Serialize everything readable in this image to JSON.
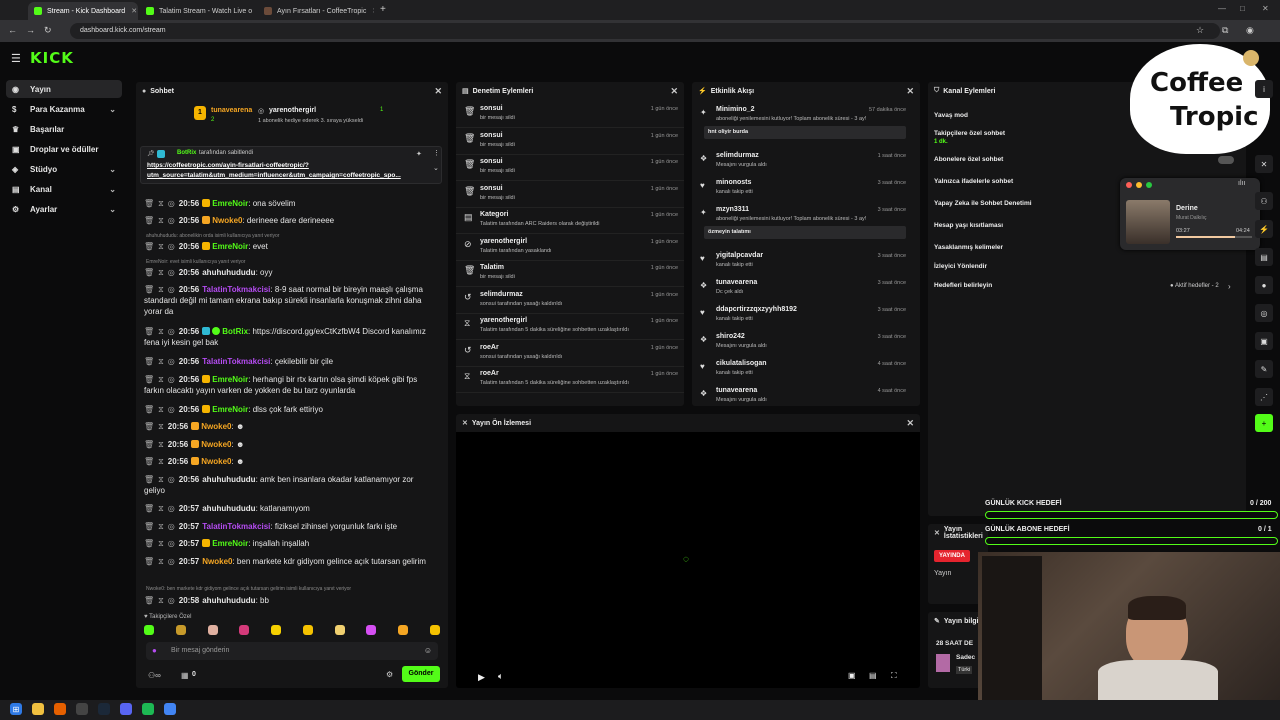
{
  "browser": {
    "tabs": [
      {
        "label": "Stream - Kick Dashboard",
        "color": "#53fc18"
      },
      {
        "label": "Talatim Stream - Watch Live o",
        "color": "#53fc18"
      },
      {
        "label": "Ayın Fırsatları - CoffeeTropic",
        "color": "#6b4b3a"
      }
    ],
    "url": "dashboard.kick.com/stream"
  },
  "brand": {
    "logo": "KICK",
    "accent": "#53fc18"
  },
  "leftnav": {
    "items": [
      {
        "label": "Yayın",
        "icon": "home-icon"
      },
      {
        "label": "Para Kazanma",
        "icon": "money-icon"
      },
      {
        "label": "Başarılar",
        "icon": "trophy-icon"
      },
      {
        "label": "Droplar ve ödüller",
        "icon": "gift-icon"
      },
      {
        "label": "Stüdyo",
        "icon": "studio-icon"
      },
      {
        "label": "Kanal",
        "icon": "channel-icon"
      },
      {
        "label": "Ayarlar",
        "icon": "gear-icon"
      }
    ]
  },
  "chat": {
    "title": "Sohbet",
    "top_user1": "tunavearena",
    "top_user1_count": "2",
    "top_user2": "yarenothergirl",
    "top_user2_count": "1",
    "top_note": "1 abonelik hediye ederek 3. sıraya yükseldi",
    "pinned_by": "BotRix",
    "pinned_label": "tarafından sabitlendi",
    "pinned_link1": "https://coffeetropic.com/ayin-firsatlari-coffeetropic/?",
    "pinned_link2": "utm_source=talatim&utm_medium=influencer&utm_campaign=coffeetropic_spo...",
    "messages": [
      {
        "time": "20:56",
        "user": "EmreNoir",
        "color": "green",
        "text": "ona sövelim"
      },
      {
        "time": "20:56",
        "user": "Nwoke0",
        "color": "orange",
        "text": "derineee dare derineeee"
      },
      {
        "reply": "ahuhuhududu: abonelikin orda isimli kullanıcıya yanıt veriyor"
      },
      {
        "time": "20:56",
        "user": "EmreNoir",
        "color": "green",
        "text": "evet"
      },
      {
        "reply": "EmreNoir: evet isimli kullanıcıya yanıt veriyor"
      },
      {
        "time": "20:56",
        "user": "ahuhuhududu",
        "color": "plain",
        "text": "oyy"
      },
      {
        "time": "20:56",
        "user": "TalatinTokmakcisi",
        "color": "purple",
        "text": "8-9 saat normal bir bireyin maaşlı çalışma standardı değil mi tamam ekrana bakıp sürekli insanlarla konuşmak zihni daha yorar da"
      },
      {
        "time": "20:56",
        "user": "BotRix",
        "color": "green",
        "text": "https://discord.gg/exCtKzfbW4 Discord kanalımız fena iyi kesin gel bak"
      },
      {
        "time": "20:56",
        "user": "TalatinTokmakcisi",
        "color": "purple",
        "text": "çekilebilir bir çile"
      },
      {
        "time": "20:56",
        "user": "EmreNoir",
        "color": "green",
        "text": "herhangi bir rtx kartın olsa şimdi köpek gibi fps farkın olacaktı yayın varken de yokken de bu tarz oyunlarda"
      },
      {
        "time": "20:56",
        "user": "EmreNoir",
        "color": "green",
        "text": "dlss çok fark ettiriyo"
      },
      {
        "time": "20:56",
        "user": "Nwoke0",
        "color": "orange",
        "text": ""
      },
      {
        "time": "20:56",
        "user": "Nwoke0",
        "color": "orange",
        "text": ""
      },
      {
        "time": "20:56",
        "user": "Nwoke0",
        "color": "orange",
        "text": ""
      },
      {
        "time": "20:56",
        "user": "ahuhuhududu",
        "color": "plain",
        "text": "amk ben insanlara okadar katlanamıyor zor geliyo"
      },
      {
        "time": "20:57",
        "user": "ahuhuhududu",
        "color": "plain",
        "text": "katlanamıyom"
      },
      {
        "time": "20:57",
        "user": "TalatinTokmakcisi",
        "color": "purple",
        "text": "fiziksel zihinsel yorgunluk farkı işte"
      },
      {
        "time": "20:57",
        "user": "EmreNoir",
        "color": "green",
        "text": "inşallah inşallah"
      },
      {
        "time": "20:57",
        "user": "Nwoke0",
        "color": "orange",
        "text": "ben markete kdr gidiyom gelince açık tutarsan gelirim"
      },
      {
        "reply": "Nwoke0: ben markete kdr gidiyom gelince açık tutarsan gelirim isimli kullanıcıya yanıt veriyor"
      },
      {
        "time": "20:58",
        "user": "ahuhuhududu",
        "color": "plain",
        "text": "bb"
      }
    ],
    "emote_label": "Takipçilere Özel",
    "input_placeholder": "Bir mesaj gönderin",
    "viewers": "0",
    "send_label": "Gönder"
  },
  "moderation": {
    "title": "Denetim Eylemleri",
    "rows": [
      {
        "icon": "trash-icon",
        "name": "sonsui",
        "sub": "bir mesajı sildi",
        "time": "1 gün önce"
      },
      {
        "icon": "trash-icon",
        "name": "sonsui",
        "sub": "bir mesajı sildi",
        "time": "1 gün önce"
      },
      {
        "icon": "trash-icon",
        "name": "sonsui",
        "sub": "bir mesajı sildi",
        "time": "1 gün önce"
      },
      {
        "icon": "trash-icon",
        "name": "sonsui",
        "sub": "bir mesajı sildi",
        "time": "1 gün önce"
      },
      {
        "icon": "category-icon",
        "name": "Kategori",
        "sub": "Talatim tarafından ARC Raiders olarak değiştirildi",
        "time": "1 gün önce"
      },
      {
        "icon": "ban-icon",
        "name": "yarenothergirl",
        "sub": "Talatim tarafından yasaklandı",
        "time": "1 gün önce"
      },
      {
        "icon": "trash-icon",
        "name": "Talatim",
        "sub": "bir mesajı sildi",
        "time": "1 gün önce"
      },
      {
        "icon": "unban-icon",
        "name": "selimdurmaz",
        "sub": "sonsui tarafından yasağı kaldırıldı",
        "time": "1 gün önce"
      },
      {
        "icon": "timeout-icon",
        "name": "yarenothergirl",
        "sub": "Talatim tarafından 5 dakika süreliğine sohbetten uzaklaştırıldı",
        "time": "1 gün önce"
      },
      {
        "icon": "unban-icon",
        "name": "roeAr",
        "sub": "sonsui tarafından yasağı kaldırıldı",
        "time": "1 gün önce"
      },
      {
        "icon": "timeout-icon",
        "name": "roeAr",
        "sub": "Talatim tarafından 5 dakika süreliğine sohbetten uzaklaştırıldı",
        "time": "1 gün önce"
      }
    ]
  },
  "activity": {
    "title": "Etkinlik Akışı",
    "rows": [
      {
        "icon": "sub-icon",
        "name": "Minimino_2",
        "sub": "aboneliği yenilemesini kutluyor! Toplam abonelik süresi - 3 ay!",
        "time": "57 dakika önce",
        "box": "hnt oliyir burda"
      },
      {
        "icon": "gift-icon",
        "name": "selimdurmaz",
        "sub": "Mesajını vurgula aldı",
        "time": "1 saat önce"
      },
      {
        "icon": "heart-icon",
        "name": "minonosts",
        "sub": "kanalı takip etti",
        "time": "3 saat önce"
      },
      {
        "icon": "sub-icon",
        "name": "mzyn3311",
        "sub": "aboneliği yenilemesini kutluyor! Toplam abonelik süresi - 3 ay!",
        "time": "3 saat önce",
        "box": "özmeyin talatımı"
      },
      {
        "icon": "heart-icon",
        "name": "yigitalpcavdar",
        "sub": "kanalı takip etti",
        "time": "3 saat önce"
      },
      {
        "icon": "gift-icon",
        "name": "tunavearena",
        "sub": "Dc çek aldı",
        "time": "3 saat önce"
      },
      {
        "icon": "heart-icon",
        "name": "ddapcrtirzzqxzyyhh8192",
        "sub": "kanalı takip etti",
        "time": "3 saat önce"
      },
      {
        "icon": "gift-icon",
        "name": "shiro242",
        "sub": "Mesajını vurgula aldı",
        "time": "3 saat önce"
      },
      {
        "icon": "heart-icon",
        "name": "cikulatalisogan",
        "sub": "kanalı takip etti",
        "time": "4 saat önce"
      },
      {
        "icon": "gift-icon",
        "name": "tunavearena",
        "sub": "Mesajını vurgula aldı",
        "time": "4 saat önce"
      }
    ]
  },
  "channel_actions": {
    "title": "Kanal Eylemleri",
    "items": [
      "Yavaş mod",
      "Takipçilere özel sohbet",
      "Abonelere özel sohbet",
      "Yalnızca ifadelerle sohbet",
      "Yapay Zeka ile Sohbet Denetimi",
      "Hesap yaşı kısıtlaması",
      "Yasaklanmış kelimeler",
      "İzleyici Yönlendir",
      "Hedefleri belirleyin"
    ],
    "follower_value": "1 dk.",
    "goals_value": "Aktif hedefler - 2"
  },
  "preview": {
    "title": "Yayın Ön İzlemesi"
  },
  "stats": {
    "title": "Yayın İstatistikleri",
    "status": "YAYINDA",
    "label": "Yayın"
  },
  "info": {
    "title": "Yayın bilgi",
    "line": "28 SAAT DE",
    "sub1": "Sadec",
    "sub2": "Türki"
  },
  "goals": {
    "kick_label": "GÜNLÜK KICK HEDEFİ",
    "kick_value": "0 / 200",
    "sub_label": "GÜNLÜK ABONE HEDEFİ",
    "sub_value": "0 / 1"
  },
  "music": {
    "title": "Derine",
    "artist": "Murat Dalkılıç",
    "elapsed": "03:27",
    "total": "04:24",
    "progress": 0.78
  },
  "sponsor": {
    "line1": "Coffee",
    "line2": "Tropic"
  }
}
